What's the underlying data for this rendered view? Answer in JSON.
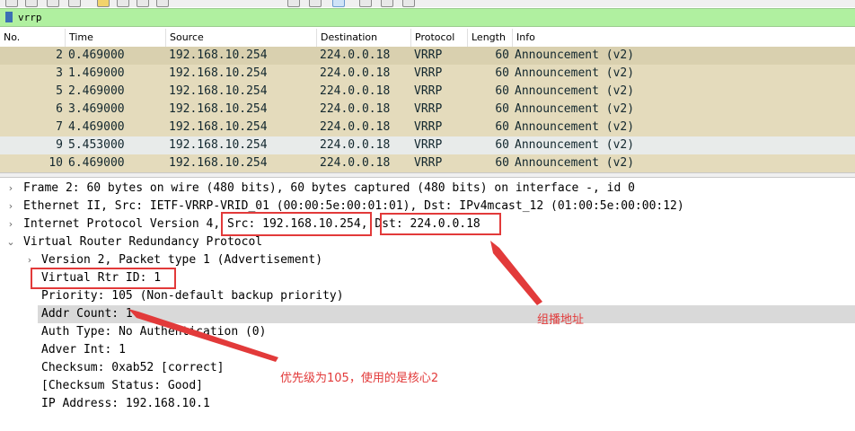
{
  "filter": {
    "value": "vrrp"
  },
  "columns": [
    "No.",
    "Time",
    "Source",
    "Destination",
    "Protocol",
    "Length",
    "Info"
  ],
  "packets": [
    {
      "no": "2",
      "time": "0.469000",
      "src": "192.168.10.254",
      "dst": "224.0.0.18",
      "proto": "VRRP",
      "len": "60",
      "info": "Announcement (v2)"
    },
    {
      "no": "3",
      "time": "1.469000",
      "src": "192.168.10.254",
      "dst": "224.0.0.18",
      "proto": "VRRP",
      "len": "60",
      "info": "Announcement (v2)"
    },
    {
      "no": "5",
      "time": "2.469000",
      "src": "192.168.10.254",
      "dst": "224.0.0.18",
      "proto": "VRRP",
      "len": "60",
      "info": "Announcement (v2)"
    },
    {
      "no": "6",
      "time": "3.469000",
      "src": "192.168.10.254",
      "dst": "224.0.0.18",
      "proto": "VRRP",
      "len": "60",
      "info": "Announcement (v2)"
    },
    {
      "no": "7",
      "time": "4.469000",
      "src": "192.168.10.254",
      "dst": "224.0.0.18",
      "proto": "VRRP",
      "len": "60",
      "info": "Announcement (v2)"
    },
    {
      "no": "9",
      "time": "5.453000",
      "src": "192.168.10.254",
      "dst": "224.0.0.18",
      "proto": "VRRP",
      "len": "60",
      "info": "Announcement (v2)"
    },
    {
      "no": "10",
      "time": "6.469000",
      "src": "192.168.10.254",
      "dst": "224.0.0.18",
      "proto": "VRRP",
      "len": "60",
      "info": "Announcement (v2)"
    }
  ],
  "details": {
    "frame": "Frame 2: 60 bytes on wire (480 bits), 60 bytes captured (480 bits) on interface -, id 0",
    "ethernet": "Ethernet II, Src: IETF-VRRP-VRID_01 (00:00:5e:00:01:01), Dst: IPv4mcast_12 (01:00:5e:00:00:12)",
    "ip_prefix": "Internet Protocol Version 4, ",
    "ip_src": "Src: 192.168.10.254",
    "ip_sep": ", ",
    "ip_dst": "Dst: 224.0.0.18",
    "vrrp": "Virtual Router Redundancy Protocol",
    "version": "Version 2, Packet type 1 (Advertisement)",
    "rtr_id": "Virtual Rtr ID: 1",
    "priority": "Priority: 105 (Non-default backup priority)",
    "addr_count": "Addr Count: 1",
    "auth_type": "Auth Type: No Authentication (0)",
    "adver_int": "Adver Int: 1",
    "checksum": "Checksum: 0xab52 [correct]",
    "checksum_status": "[Checksum Status: Good]",
    "ip_address": "IP Address: 192.168.10.1"
  },
  "annotations": {
    "multicast": "组播地址",
    "priority_note": "优先级为105，使用的是核心2"
  },
  "colors": {
    "row_vrrp": "#e4dbbc",
    "row_alt": "#e8ebea",
    "annotation_red": "#e23a3a",
    "filter_bg": "#b0f0a0"
  }
}
